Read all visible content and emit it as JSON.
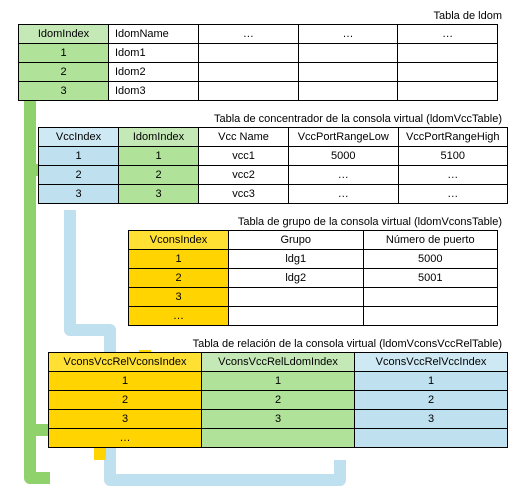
{
  "ellipsis": "…",
  "ldom": {
    "title": "Tabla de ldom",
    "headers": {
      "index": "IdomIndex",
      "name": "IdomName"
    },
    "rows": [
      {
        "index": "1",
        "name": "Idom1"
      },
      {
        "index": "2",
        "name": "Idom2"
      },
      {
        "index": "3",
        "name": "Idom3"
      }
    ]
  },
  "vcc": {
    "title": "Tabla de concentrador de la consola virtual (ldomVccTable)",
    "headers": {
      "vccIndex": "VccIndex",
      "ldomIndex": "IdomIndex",
      "name": "Vcc Name",
      "low": "VccPortRangeLow",
      "high": "VccPortRangeHigh"
    },
    "rows": [
      {
        "vccIndex": "1",
        "ldomIndex": "1",
        "name": "vcc1",
        "low": "5000",
        "high": "5100"
      },
      {
        "vccIndex": "2",
        "ldomIndex": "2",
        "name": "vcc2",
        "low": "…",
        "high": "…"
      },
      {
        "vccIndex": "3",
        "ldomIndex": "3",
        "name": "vcc3",
        "low": "…",
        "high": "…"
      }
    ]
  },
  "vcons": {
    "title": "Tabla de grupo de la consola virtual (ldomVconsTable)",
    "headers": {
      "index": "VconsIndex",
      "group": "Grupo",
      "port": "Número de puerto"
    },
    "rows": [
      {
        "index": "1",
        "group": "ldg1",
        "port": "5000"
      },
      {
        "index": "2",
        "group": "ldg2",
        "port": "5001"
      },
      {
        "index": "3",
        "group": "",
        "port": ""
      },
      {
        "index": "…",
        "group": "",
        "port": ""
      }
    ]
  },
  "rel": {
    "title": "Tabla de relación de la consola virtual (ldomVconsVccRelTable)",
    "headers": {
      "vconsIdx": "VconsVccRelVconsIndex",
      "ldomIdx": "VconsVccRelLdomIndex",
      "vccIdx": "VconsVccRelVccIndex"
    },
    "rows": [
      {
        "vconsIdx": "1",
        "ldomIdx": "1",
        "vccIdx": "1"
      },
      {
        "vconsIdx": "2",
        "ldomIdx": "2",
        "vccIdx": "2"
      },
      {
        "vconsIdx": "3",
        "ldomIdx": "3",
        "vccIdx": "3"
      },
      {
        "vconsIdx": "…",
        "ldomIdx": "",
        "vccIdx": ""
      }
    ]
  }
}
